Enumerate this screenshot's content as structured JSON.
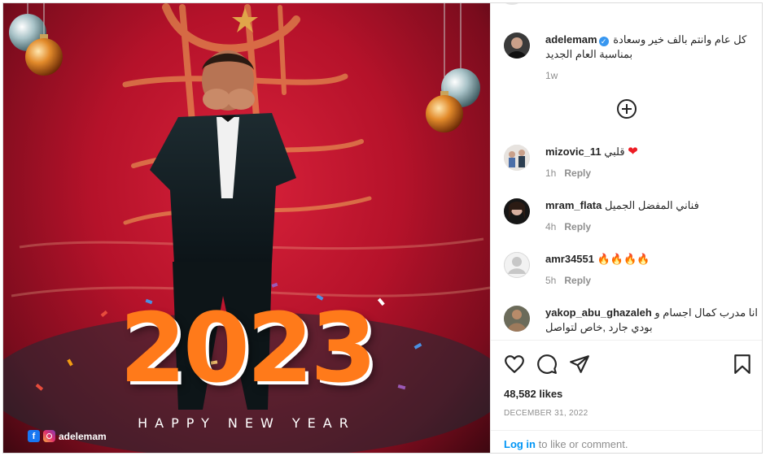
{
  "post_image": {
    "year": "2023",
    "greeting": "HAPPY NEW YEAR",
    "handle": "adelemam",
    "colors": {
      "background": "#b5122a",
      "year_orange": "#ff7a1a",
      "year_red": "#ea2a1f",
      "gold": "#e0a64a"
    }
  },
  "caption": {
    "username": "adelemam",
    "verified": true,
    "text": "كل عام وانتم بالف خير وسعادة بمناسبة العام الجديد",
    "time": "1w"
  },
  "load_more_icon": "plus-circle-icon",
  "comments": [
    {
      "username": "mizovic_11",
      "text": "قلبي",
      "emoji": "❤",
      "time": "1h",
      "reply": "Reply"
    },
    {
      "username": "mram_flata",
      "text": "فناني المفضل الجميل",
      "emoji": "",
      "time": "4h",
      "reply": "Reply"
    },
    {
      "username": "amr34551",
      "text": "🔥🔥🔥🔥",
      "emoji": "",
      "time": "5h",
      "reply": "Reply"
    },
    {
      "username": "yakop_abu_ghazaleh",
      "text": "انا مدرب كمال اجسام و بودي جارد ,خاص لتواصل",
      "emoji": "",
      "time": "",
      "reply": ""
    }
  ],
  "actions": {
    "icons": [
      "heart-icon",
      "comment-icon",
      "share-icon",
      "bookmark-icon"
    ],
    "likes": "48,582 likes",
    "date": "DECEMBER 31, 2022"
  },
  "login": {
    "link": "Log in",
    "rest": " to like or comment."
  }
}
